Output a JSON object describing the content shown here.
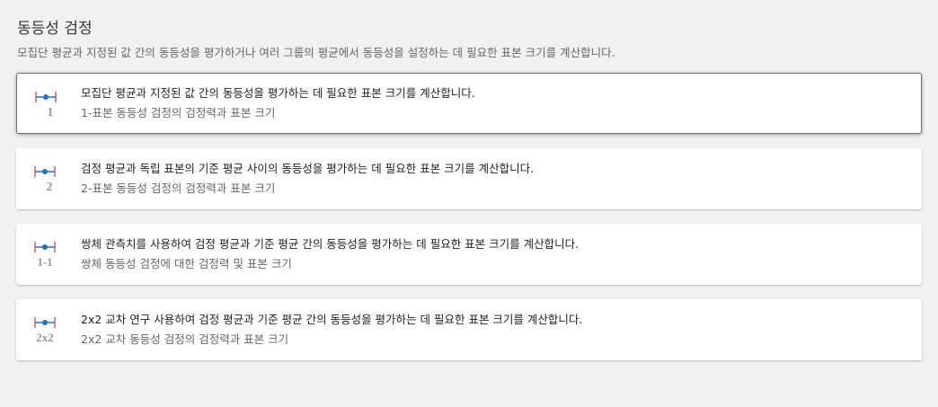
{
  "header": {
    "title": "동등성 검정",
    "subtitle": "모집단 평균과 지정된 값 간의 동등성을 평가하거나 여러 그룹의 평균에서 동등성을 설정하는 데 필요한 표본 크기를 계산합니다."
  },
  "colors": {
    "bracket": "#d9534f",
    "dot": "#2a6fb5",
    "digit": "#9a9a9a"
  },
  "options": [
    {
      "icon": "equivalence-1-sample-icon",
      "icon_label": "1",
      "description": "모집단 평균과 지정된 값 간의 동등성을 평가하는 데 필요한 표본 크기를 계산합니다.",
      "title": "1-표본 동등성 검정의 검정력과 표본 크기",
      "selected": true
    },
    {
      "icon": "equivalence-2-sample-icon",
      "icon_label": "2",
      "description": "검정 평균과 독립 표본의 기준 평균 사이의 동등성을 평가하는 데 필요한 표본 크기를 계산합니다.",
      "title": "2-표본 동등성 검정의 검정력과 표본 크기",
      "selected": false
    },
    {
      "icon": "equivalence-paired-icon",
      "icon_label": "1-1",
      "description": "쌍체 관측치를 사용하여 검정 평균과 기준 평균 간의 동등성을 평가하는 데 필요한 표본 크기를 계산합니다.",
      "title": "쌍체 동등성 검정에 대한 검정력 및 표본 크기",
      "selected": false
    },
    {
      "icon": "equivalence-2x2-crossover-icon",
      "icon_label": "2x2",
      "description": "2x2 교차 연구 사용하여 검정 평균과 기준 평균 간의 동등성을 평가하는 데 필요한 표본 크기를 계산합니다.",
      "title": "2x2 교차 동등성 검정의 검정력과 표본 크기",
      "selected": false
    }
  ]
}
